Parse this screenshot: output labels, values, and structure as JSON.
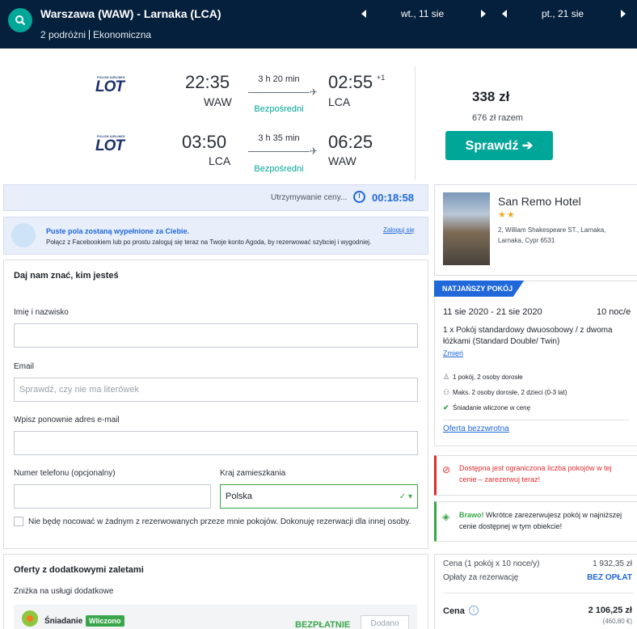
{
  "header": {
    "route": "Warszawa (WAW) - Larnaka (LCA)",
    "travellers": "2 podróżni",
    "cabin": "Ekonomiczna",
    "depart_date": "wt., 11 sie",
    "return_date": "pt., 21 sie"
  },
  "flights": {
    "airline_small": "POLISH AIRLINES",
    "airline_logo": "LOT",
    "outbound": {
      "dep_time": "22:35",
      "dep_ap": "WAW",
      "duration": "3 h 20 min",
      "stops": "Bezpośredni",
      "arr_time": "02:55",
      "arr_day": "+1",
      "arr_ap": "LCA"
    },
    "inbound": {
      "dep_time": "03:50",
      "dep_ap": "LCA",
      "duration": "3 h 35 min",
      "stops": "Bezpośredni",
      "arr_time": "06:25",
      "arr_ap": "WAW"
    },
    "price": "338 zł",
    "price_total": "676 zł razem",
    "check_label": "Sprawdź ➔"
  },
  "timer": {
    "label": "Utrzymywanie ceny...",
    "value": "00:18:58"
  },
  "facebook": {
    "title": "Puste pola zostaną wypełnione za Ciebie.",
    "text": "Połącz z Facebookiem lub po prostu zaloguj się teraz na Twoje konto Agoda, by rezerwować szybciej i wygodniej.",
    "login": "Zaloguj się"
  },
  "form": {
    "title": "Daj nam znać, kim jesteś",
    "name_label": "Imię i nazwisko",
    "name_value": "",
    "email_label": "Email",
    "email_placeholder": "Sprawdź, czy nie ma literówek",
    "email2_label": "Wpisz ponownie adres e-mail",
    "email2_value": "",
    "phone_label": "Numer telefonu (opcjonalny)",
    "phone_value": "",
    "country_label": "Kraj zamieszkania",
    "country_value": "Polska",
    "not_staying": "Nie będę nocować w żadnym z rezerwowanych przeze mnie pokojów. Dokonuję rezerwacji dla innej osoby."
  },
  "offers": {
    "title": "Oferty z dodatkowymi zaletami",
    "subtitle": "Zniżka na usługi dodatkowe",
    "breakfast": "Śniadanie",
    "badge": "Wliczono",
    "free": "BEZPŁATNIE",
    "add": "Dodano"
  },
  "hotel": {
    "name": "San Remo Hotel",
    "stars": "★★",
    "address": "2, William Shakespeare ST., Larnaka, Larnaka, Cypr 6531"
  },
  "room": {
    "badge": "NATJAŃSZY POKÓJ",
    "dates": "11 sie 2020 - 21 sie 2020",
    "nights": "10 noc/e",
    "desc": "1 x Pokój standardowy dwuosobowy / z dwoma łóżkami (Standard Double/ Twin)",
    "change": "Zmień",
    "feat1": "1 pokój, 2 osoby dorosłe",
    "feat2": "Maks. 2 osoby dorosłe, 2 dzieci (0-3 lat)",
    "feat3": "Śniadanie wliczone w cenę",
    "nonref": "Oferta bezzwrotna"
  },
  "alerts": {
    "limited": "Dostępna jest ograniczona liczba pokojów w tej cenie – zarezerwuj teraz!",
    "bravo": "Brawo!",
    "bravo_text": " Wkrótce zarezerwujesz pokój w najniższej cenie dostępnej w tym obiekcie!"
  },
  "summary": {
    "price_label": "Cena (1 pokój x 10 noce/y)",
    "price_value": "1 932,35 zł",
    "fee_label": "Opłaty za rezerwację",
    "fee_value": "BEZ OPŁAT",
    "total_label": "Cena",
    "total_value": "2 106,25 zł",
    "total_eur": "(460,80 €)"
  },
  "colors": {
    "header_bg": "#05203c",
    "accent": "#00a698",
    "link": "#2067da",
    "success": "#3aa64a",
    "alert": "#e12d2d"
  }
}
